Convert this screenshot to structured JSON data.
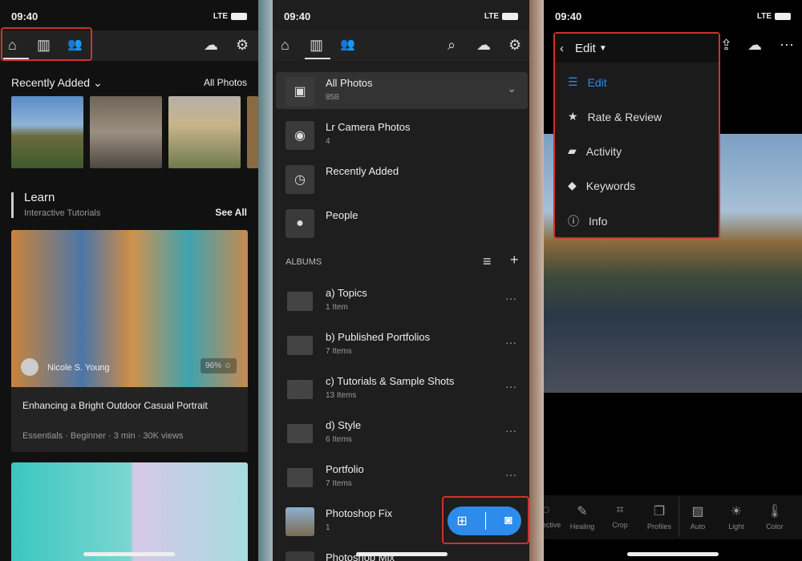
{
  "status": {
    "time": "09:40",
    "network": "LTE"
  },
  "home": {
    "tabs": [
      {
        "name": "home",
        "icon": "⌂"
      },
      {
        "name": "library",
        "icon": "▥"
      },
      {
        "name": "people",
        "icon": "👥"
      }
    ],
    "recent_title": "Recently Added",
    "all_photos": "All Photos",
    "learn_title": "Learn",
    "learn_sub": "Interactive Tutorials",
    "see_all": "See All",
    "card": {
      "author": "Nicole S. Young",
      "rating": "96%",
      "title": "Enhancing a Bright Outdoor Casual Portrait",
      "meta": "Essentials · Beginner · 3 min · 30K views"
    }
  },
  "library": {
    "items": [
      {
        "label": "All Photos",
        "sub": "858",
        "icon": "▣"
      },
      {
        "label": "Lr Camera Photos",
        "sub": "4",
        "icon": "◉"
      },
      {
        "label": "Recently Added",
        "sub": "",
        "icon": "◷"
      },
      {
        "label": "People",
        "sub": "",
        "icon": "●"
      }
    ],
    "albums_header": "ALBUMS",
    "albums": [
      {
        "label": "a) Topics",
        "sub": "1 Item"
      },
      {
        "label": "b) Published Portfolios",
        "sub": "7 Items"
      },
      {
        "label": "c) Tutorials & Sample Shots",
        "sub": "13 Items"
      },
      {
        "label": "d) Style",
        "sub": "6 Items"
      },
      {
        "label": "Portfolio",
        "sub": "7 Items"
      },
      {
        "label": "Photoshop Fix",
        "sub": "1"
      },
      {
        "label": "Photoshop Mix",
        "sub": ""
      }
    ]
  },
  "editor": {
    "mode": "Edit",
    "menu": [
      {
        "label": "Edit",
        "icon": "☰"
      },
      {
        "label": "Rate & Review",
        "icon": "★"
      },
      {
        "label": "Activity",
        "icon": "▰"
      },
      {
        "label": "Keywords",
        "icon": "◆"
      },
      {
        "label": "Info",
        "icon": "ⓘ"
      }
    ],
    "tools": [
      {
        "label": "Selective",
        "icon": "◌"
      },
      {
        "label": "Healing",
        "icon": "✎"
      },
      {
        "label": "Crop",
        "icon": "⌗"
      },
      {
        "label": "Profiles",
        "icon": "❐"
      },
      {
        "label": "Auto",
        "icon": "▨"
      },
      {
        "label": "Light",
        "icon": "☀"
      },
      {
        "label": "Color",
        "icon": "🌡"
      }
    ],
    "accent": "#2d8ceb"
  }
}
